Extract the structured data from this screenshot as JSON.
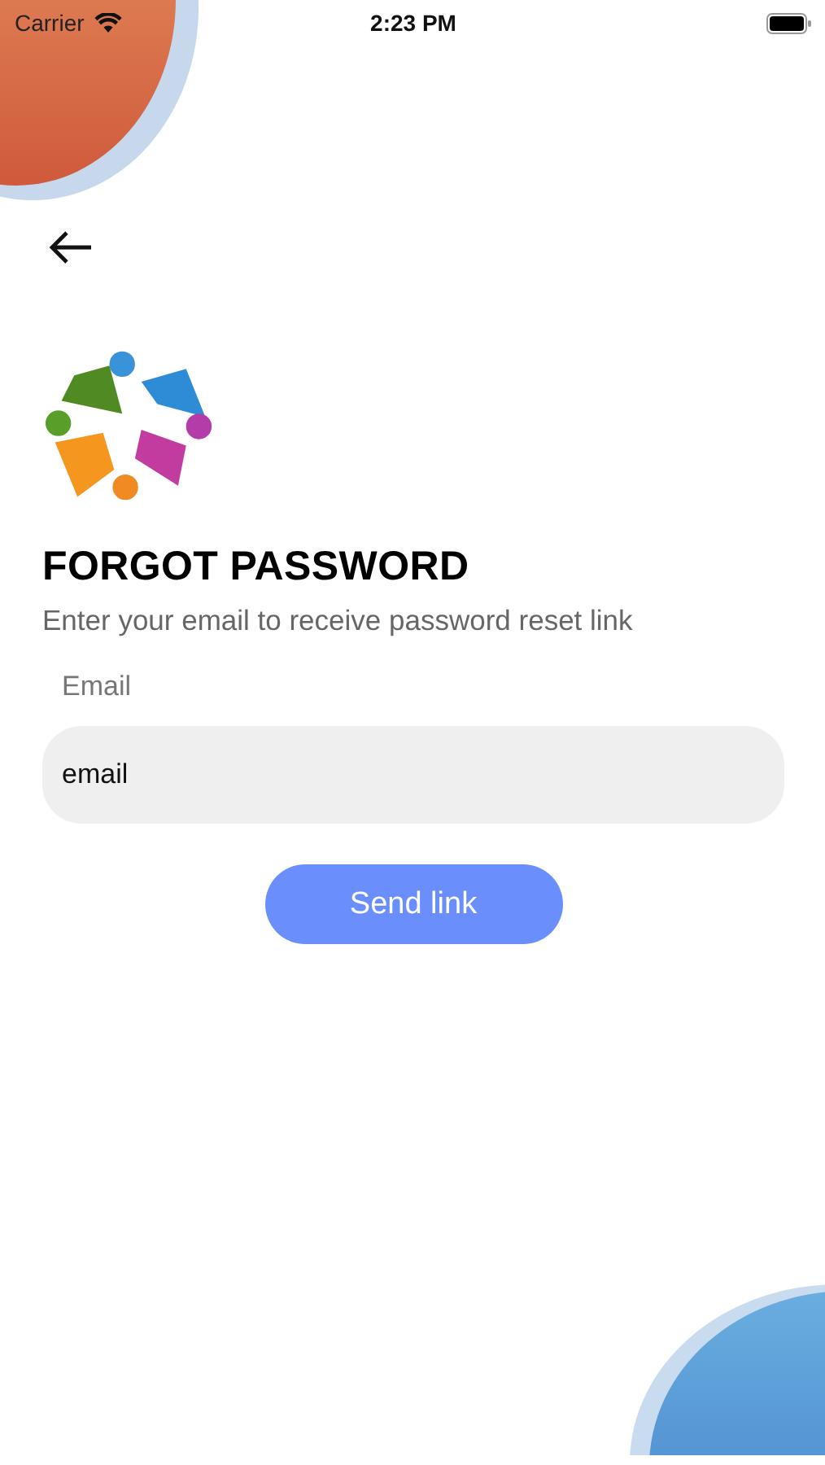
{
  "status_bar": {
    "carrier": "Carrier",
    "time": "2:23 PM"
  },
  "title": "FORGOT PASSWORD",
  "subtitle": "Enter your email to receive password reset link",
  "email_field": {
    "label": "Email",
    "value": "email"
  },
  "buttons": [
    {
      "label": "Send link"
    }
  ]
}
